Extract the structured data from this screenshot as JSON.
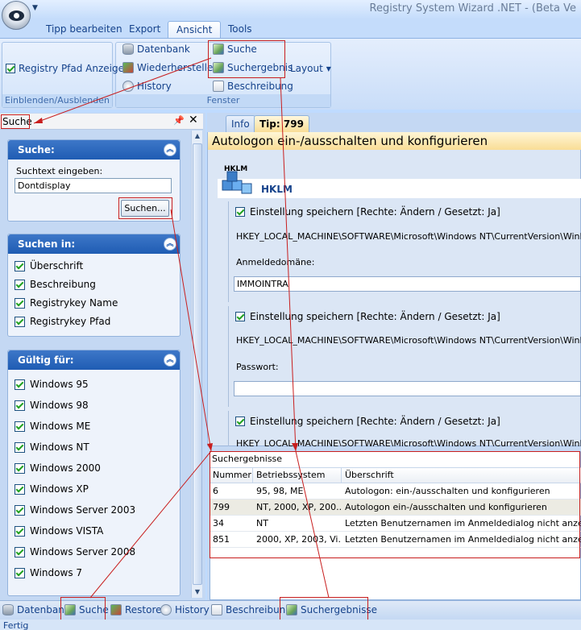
{
  "window": {
    "title": "Registry System Wizard .NET - (Beta Ve"
  },
  "ribbon": {
    "tabs": [
      "Tipp bearbeiten",
      "Export",
      "Ansicht",
      "Tools"
    ],
    "active_tab": "Ansicht",
    "groups": {
      "show_hide": {
        "label": "Einblenden/Ausblenden",
        "registry_path_checkbox": "Registry Pfad Anzeigen"
      },
      "window": {
        "label": "Fenster",
        "datenbank": "Datenbank",
        "wiederherstellen": "Wiederherstellen",
        "history": "History",
        "suche": "Suche",
        "suchergebnis": "Suchergebnis",
        "beschreibung": "Beschreibung",
        "layout": "Layout"
      }
    }
  },
  "search_pane": {
    "title": "Suche",
    "search_panel": {
      "header": "Suche:",
      "prompt": "Suchtext eingeben:",
      "input_value": "Dontdisplay",
      "button": "Suchen..."
    },
    "search_in_panel": {
      "header": "Suchen in:",
      "items": [
        "Überschrift",
        "Beschreibung",
        "Registrykey Name",
        "Registrykey Pfad"
      ]
    },
    "valid_for_panel": {
      "header": "Gültig für:",
      "items": [
        "Windows 95",
        "Windows 98",
        "Windows ME",
        "Windows NT",
        "Windows 2000",
        "Windows XP",
        "Windows Server 2003",
        "Windows VISTA",
        "Windows Server 2008",
        "Windows 7"
      ]
    }
  },
  "document": {
    "tabs": {
      "info": "Info",
      "tip": "Tip: 799"
    },
    "title": "Autologon ein-/ausschalten und konfigurieren",
    "hive_short": "HKLM",
    "hive_label": "HKLM",
    "settings": [
      {
        "check_label": "Einstellung speichern [Rechte: Ändern / Gesetzt: Ja]",
        "key": "HKEY_LOCAL_MACHINE\\SOFTWARE\\Microsoft\\Windows NT\\CurrentVersion\\Winlogon",
        "field_label": "Anmeldedomäne:",
        "field_value": "IMMOINTRA"
      },
      {
        "check_label": "Einstellung speichern [Rechte: Ändern / Gesetzt: Ja]",
        "key": "HKEY_LOCAL_MACHINE\\SOFTWARE\\Microsoft\\Windows NT\\CurrentVersion\\Winlogon",
        "field_label": "Passwort:",
        "field_value": ""
      },
      {
        "check_label": "Einstellung speichern [Rechte: Ändern / Gesetzt: Ja]",
        "key": "HKEY_LOCAL_MACHINE\\SOFTWARE\\Microsoft\\Windows NT\\CurrentVersion\\Winlogon"
      }
    ]
  },
  "results": {
    "title": "Suchergebnisse",
    "columns": [
      "Nummer",
      "Betriebssystem",
      "Überschrift"
    ],
    "rows": [
      [
        "6",
        "95, 98, ME",
        "Autologon: ein-/ausschalten und konfigurieren"
      ],
      [
        "799",
        "NT, 2000, XP, 200...",
        "Autologon ein-/ausschalten und konfigurieren"
      ],
      [
        "34",
        "NT",
        "Letzten Benutzernamen im Anmeldedialog nicht anzeigen"
      ],
      [
        "851",
        "2000, XP, 2003, Vi...",
        "Letzten Benutzernamen im Anmeldedialog nicht anzeigen"
      ]
    ],
    "selected_row": 1
  },
  "bottom_tabs": [
    "Datenbank",
    "Suche",
    "Restore",
    "History",
    "Beschreibung",
    "Suchergebnisse"
  ],
  "status": "Fertig",
  "colors": {
    "highlight": "#c81e1e",
    "panel_header": "#1f5cb3",
    "accent_tab": "#f9dd96"
  }
}
